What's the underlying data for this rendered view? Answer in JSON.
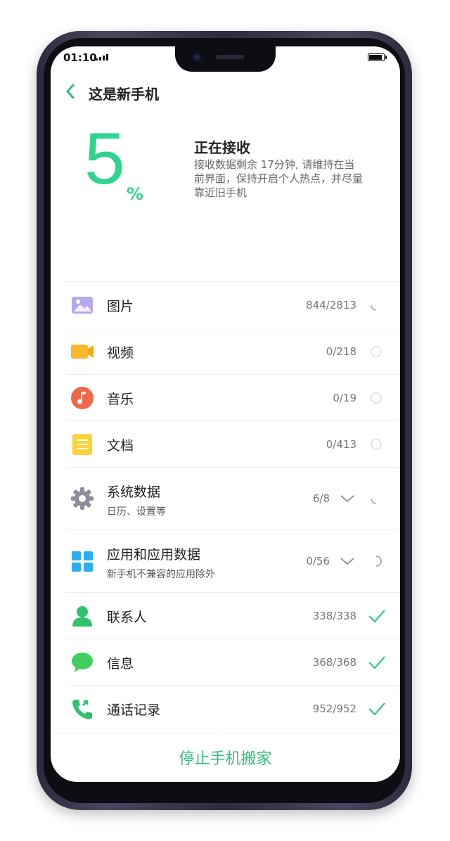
{
  "status_bar": {
    "time": "01:10"
  },
  "header": {
    "title": "这是新手机"
  },
  "progress": {
    "percent_value": "5",
    "percent_sign": "%",
    "title": "正在接收",
    "description": "接收数据剩余 17分钟, 请维持在当前界面，保持开启个人热点，并尽量靠近旧手机"
  },
  "items": [
    {
      "label": "图片",
      "count": "844/2813",
      "state": "loading-icon"
    },
    {
      "label": "视频",
      "count": "0/218",
      "state": "pending-icon"
    },
    {
      "label": "音乐",
      "count": "0/19",
      "state": "pending-icon"
    },
    {
      "label": "文档",
      "count": "0/413",
      "state": "pending-icon"
    },
    {
      "label": "系统数据",
      "sub": "日历、设置等",
      "count": "6/8",
      "state": "loading-icon"
    },
    {
      "label": "应用和应用数据",
      "sub": "新手机不兼容的应用除外",
      "count": "0/56",
      "state": "loading-icon"
    },
    {
      "label": "联系人",
      "count": "338/338",
      "state": "check-icon"
    },
    {
      "label": "信息",
      "count": "368/368",
      "state": "check-icon"
    },
    {
      "label": "通话记录",
      "count": "952/952",
      "state": "check-icon"
    }
  ],
  "footer": {
    "stop_label": "停止手机搬家"
  },
  "colors": {
    "accent": "#2fd48e",
    "button_text": "#2fbe7e",
    "check": "#3cc48a"
  }
}
